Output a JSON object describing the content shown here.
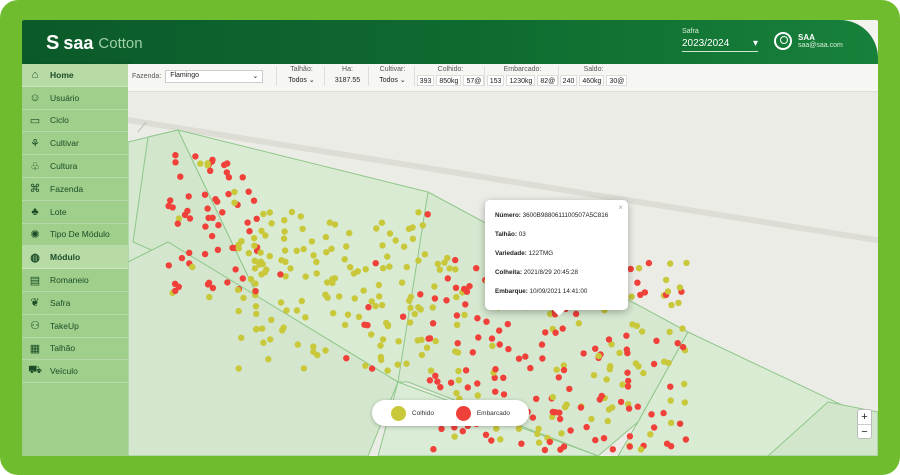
{
  "app": {
    "logo_s": "S",
    "logo_brand": "saa",
    "logo_product": "Cotton"
  },
  "header": {
    "safra_label": "Safra",
    "safra_value": "2023/2024",
    "user_name": "SAA",
    "user_email": "saa@saa.com"
  },
  "sidebar": {
    "items": [
      {
        "label": "Home",
        "icon": "home-icon"
      },
      {
        "label": "Usuário",
        "icon": "user-icon"
      },
      {
        "label": "Ciclo",
        "icon": "monitor-icon"
      },
      {
        "label": "Cultivar",
        "icon": "sprout-icon"
      },
      {
        "label": "Cultura",
        "icon": "plant-hand-icon"
      },
      {
        "label": "Fazenda",
        "icon": "farm-icon"
      },
      {
        "label": "Lote",
        "icon": "tree-icon"
      },
      {
        "label": "Tipo De Módulo",
        "icon": "bulb-icon"
      },
      {
        "label": "Módulo",
        "icon": "globe-icon"
      },
      {
        "label": "Romaneio",
        "icon": "document-icon"
      },
      {
        "label": "Safra",
        "icon": "leaf-icon"
      },
      {
        "label": "TakeUp",
        "icon": "people-icon"
      },
      {
        "label": "Talhão",
        "icon": "grid-icon"
      },
      {
        "label": "Veículo",
        "icon": "vehicle-icon"
      }
    ]
  },
  "filters": {
    "fazenda_label": "Fazenda:",
    "fazenda_value": "Flamingo",
    "talhao_label": "Talhão:",
    "talhao_value": "Todos",
    "ha_label": "Ha:",
    "ha_value": "3187.55",
    "cultivar_label": "Cultivar:",
    "cultivar_value": "Todos",
    "colhido_label": "Colhido:",
    "colhido_values": [
      "393",
      "850kg",
      "57@"
    ],
    "embarcado_label": "Embarcado:",
    "embarcado_values": [
      "153",
      "1230kg",
      "82@"
    ],
    "saldo_label": "Saldo:",
    "saldo_values": [
      "240",
      "460kg",
      "30@"
    ]
  },
  "popup": {
    "numero_label": "Número:",
    "numero_value": "3600B9880611100507A5C816",
    "talhao_label": "Talhão:",
    "talhao_value": "03",
    "variedade_label": "Variedade:",
    "variedade_value": "122TMG",
    "colheita_label": "Colheita:",
    "colheita_value": "2021/8/29 20:45:28",
    "embarque_label": "Embarque:",
    "embarque_value": "10/09/2021 14:41:00",
    "close": "×"
  },
  "legend": {
    "colhido_label": "Colhido",
    "embarcado_label": "Embarcado",
    "colhido_color": "#c8c83a",
    "embarcado_color": "#f0403a"
  },
  "zoom": {
    "in": "+",
    "out": "−"
  },
  "colors": {
    "accent": "#0f6b30",
    "frame": "#6fbd2f",
    "sidebar": "#9fcf8a"
  }
}
